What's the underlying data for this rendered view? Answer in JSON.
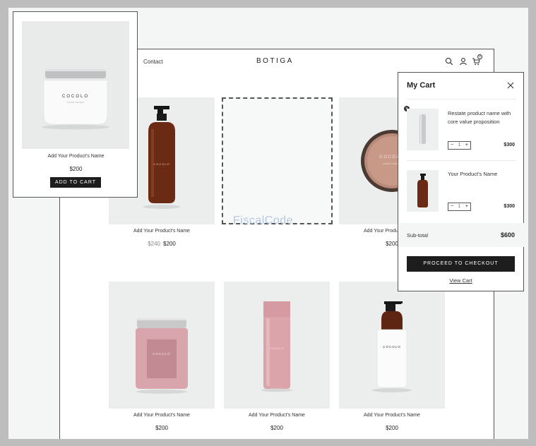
{
  "header": {
    "nav_link": "Contact",
    "brand": "BOTIGA",
    "cart_count": "0"
  },
  "products": [
    {
      "name": "Add Your Product's Name",
      "old_price": "$240",
      "price": "$200",
      "image": "amber-pump-bottle"
    },
    {
      "name": "Add Your Product's Name",
      "old_price": "",
      "price": "$200",
      "image": "cream-jar-terracotta"
    },
    {
      "name": "Add Your Product's Name",
      "old_price": "",
      "price": "$200",
      "image": "pink-jar"
    },
    {
      "name": "Add Your Product's Name",
      "old_price": "",
      "price": "$200",
      "image": "pink-tube"
    },
    {
      "name": "Add Your Product's Name",
      "old_price": "",
      "price": "$200",
      "image": "white-pump-bottle"
    }
  ],
  "placeholder": {
    "watermark": "FiscalCode"
  },
  "zoom_card": {
    "name": "Add Your Product's Name",
    "price": "$200",
    "button": "ADD TO CART",
    "jar_label": "COCOLO"
  },
  "cart": {
    "title": "My Cart",
    "items": [
      {
        "name": "Restate product name with core value proposition",
        "qty": "1",
        "price": "$300"
      },
      {
        "name": "Your Product's Name",
        "qty": "1",
        "price": "$300"
      }
    ],
    "subtotal_label": "Sub-total",
    "subtotal_value": "$600",
    "checkout_label": "PROCEED TO CHECKOUT",
    "view_cart_label": "View Cart"
  },
  "colors": {
    "dark": "#1d1d1d",
    "panel": "#f4f5f5",
    "amber": "#6b2a14",
    "pink": "#d9a5ad"
  }
}
